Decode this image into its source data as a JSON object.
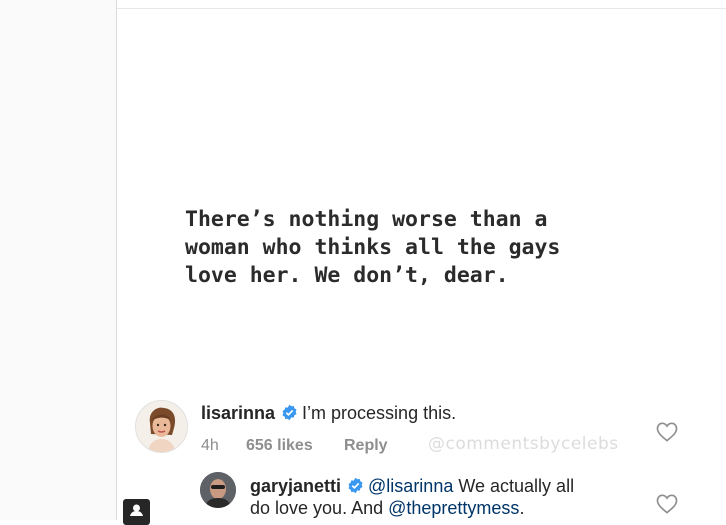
{
  "post": {
    "quote_lines": [
      "There’s nothing worse than a",
      "woman who thinks all the gays",
      "love her. We don’t, dear."
    ]
  },
  "comments": [
    {
      "username": "lisarinna",
      "text": "I’m processing this.",
      "time": "4h",
      "likes": "656 likes",
      "reply_label": "Reply",
      "watermark": "@commentsbycelebs"
    },
    {
      "username": "garyjanetti",
      "mention1": "@lisarinna",
      "text1": " We actually all",
      "text2": "do love you. And ",
      "mention2": "@theprettymess",
      "text3": "."
    }
  ],
  "colors": {
    "verified_blue": "#3897f0",
    "mention": "#003569",
    "meta_gray": "#8e8e8e"
  },
  "icons": [
    "verified-badge-icon",
    "heart-icon",
    "camera-icon"
  ]
}
